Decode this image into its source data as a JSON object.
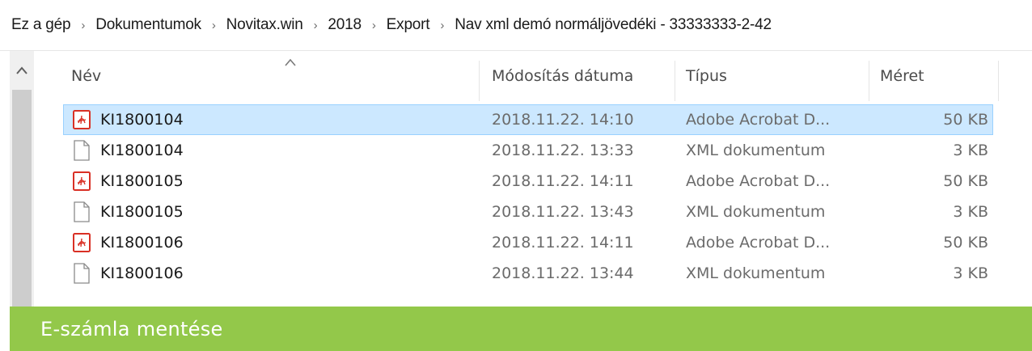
{
  "breadcrumb": {
    "items": [
      "Ez a gép",
      "Dokumentumok",
      "Novitax.win",
      "2018",
      "Export",
      "Nav xml demó normáljövedéki - 33333333-2-42"
    ]
  },
  "columns": {
    "name": "Név",
    "date": "Módosítás dátuma",
    "type": "Típus",
    "size": "Méret"
  },
  "rows": [
    {
      "name": "KI1800104",
      "date": "2018.11.22. 14:10",
      "type": "Adobe Acrobat D...",
      "size": "50 KB",
      "icon": "pdf-file-icon",
      "selected": true
    },
    {
      "name": "KI1800104",
      "date": "2018.11.22. 13:33",
      "type": "XML dokumentum",
      "size": "3 KB",
      "icon": "blank-file-icon",
      "selected": false
    },
    {
      "name": "KI1800105",
      "date": "2018.11.22. 14:11",
      "type": "Adobe Acrobat D...",
      "size": "50 KB",
      "icon": "pdf-file-icon",
      "selected": false
    },
    {
      "name": "KI1800105",
      "date": "2018.11.22. 13:43",
      "type": "XML dokumentum",
      "size": "3 KB",
      "icon": "blank-file-icon",
      "selected": false
    },
    {
      "name": "KI1800106",
      "date": "2018.11.22. 14:11",
      "type": "Adobe Acrobat D...",
      "size": "50 KB",
      "icon": "pdf-file-icon",
      "selected": false
    },
    {
      "name": "KI1800106",
      "date": "2018.11.22. 13:44",
      "type": "XML dokumentum",
      "size": "3 KB",
      "icon": "blank-file-icon",
      "selected": false
    }
  ],
  "footer": {
    "caption": "E-számla mentése"
  },
  "colors": {
    "selection_bg": "#cce8ff",
    "selection_border": "#99d1ff",
    "footer_bg": "#93c84a",
    "pdf_red": "#d93025"
  }
}
